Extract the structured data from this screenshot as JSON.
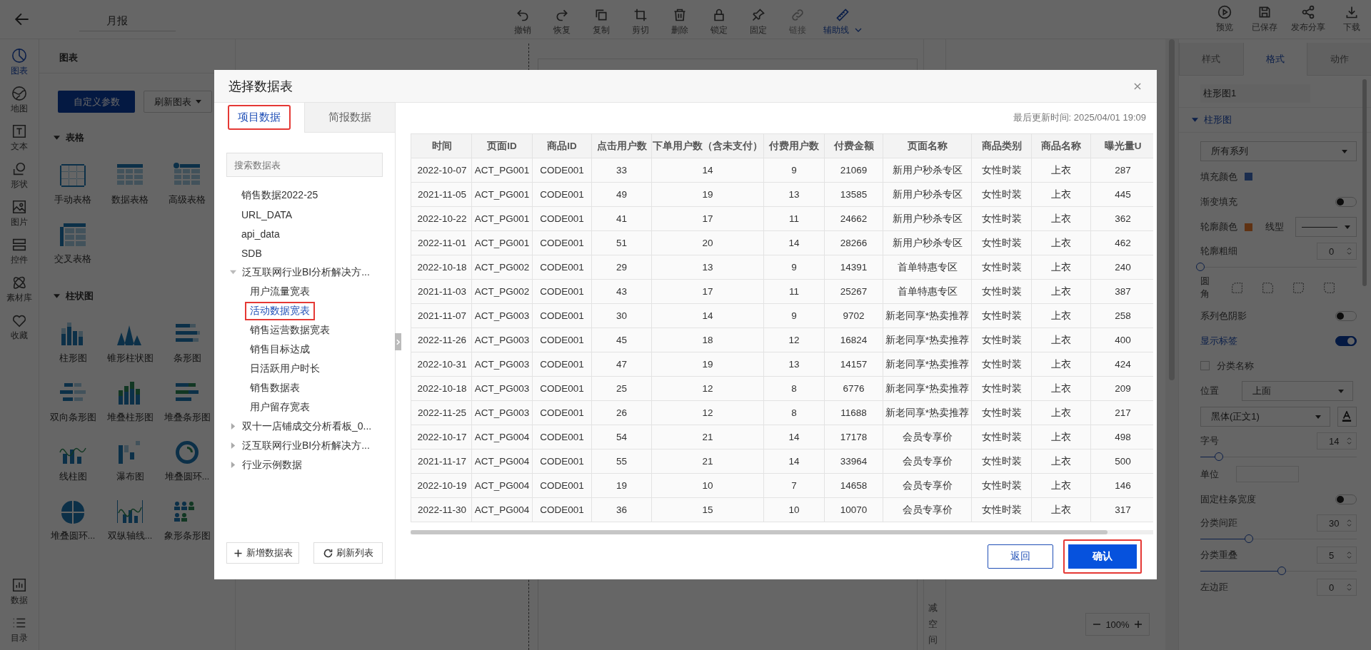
{
  "top_bar": {
    "title": "月报",
    "tools": [
      {
        "label": "撤销",
        "disabled": false,
        "selected": false,
        "has_menu": false
      },
      {
        "label": "恢复",
        "disabled": false,
        "selected": false,
        "has_menu": false
      },
      {
        "label": "复制",
        "disabled": false,
        "selected": false,
        "has_menu": false
      },
      {
        "label": "剪切",
        "disabled": false,
        "selected": false,
        "has_menu": false
      },
      {
        "label": "删除",
        "disabled": false,
        "selected": false,
        "has_menu": false
      },
      {
        "label": "锁定",
        "disabled": false,
        "selected": false,
        "has_menu": false
      },
      {
        "label": "固定",
        "disabled": false,
        "selected": false,
        "has_menu": false
      },
      {
        "label": "链接",
        "disabled": true,
        "selected": false,
        "has_menu": false
      },
      {
        "label": "辅助线",
        "disabled": false,
        "selected": true,
        "has_menu": true
      }
    ],
    "actions": [
      {
        "label": "预览"
      },
      {
        "label": "已保存"
      },
      {
        "label": "发布分享"
      },
      {
        "label": "下载"
      }
    ]
  },
  "rail": {
    "items": [
      {
        "label": "图表",
        "selected": true
      },
      {
        "label": "地图",
        "selected": false
      },
      {
        "label": "文本",
        "selected": false
      },
      {
        "label": "形状",
        "selected": false
      },
      {
        "label": "图片",
        "selected": false
      },
      {
        "label": "控件",
        "selected": false
      },
      {
        "label": "素材库",
        "selected": false
      },
      {
        "label": "收藏",
        "selected": false
      }
    ],
    "bottom_items": [
      {
        "label": "数据",
        "selected": false
      },
      {
        "label": "目录",
        "selected": false
      }
    ]
  },
  "left_panel": {
    "title": "图表",
    "buttons": [
      {
        "label": "自定义参数",
        "kind": "primary"
      },
      {
        "label": "刷新图表",
        "kind": "dropdown"
      }
    ],
    "sections": [
      {
        "title": "表格",
        "expanded": true,
        "items": [
          "手动表格",
          "数据表格",
          "高级表格",
          "交叉表格"
        ]
      },
      {
        "title": "柱状图",
        "expanded": true,
        "items": [
          "柱形图",
          "锥形柱状图",
          "条形图",
          "双向条形图",
          "堆叠柱形图",
          "堆叠条形图",
          "线柱图",
          "瀑布图",
          "堆叠圆环...",
          "堆叠圆环...",
          "双纵轴线...",
          "象形条形图"
        ]
      }
    ]
  },
  "canvas": {
    "side_text": "减空间",
    "zoom": "100%"
  },
  "right_panel": {
    "tabs": [
      {
        "label": "样式",
        "selected": false
      },
      {
        "label": "格式",
        "selected": true
      },
      {
        "label": "动作",
        "selected": false
      }
    ],
    "name": "柱形图1",
    "section": {
      "title": "柱形图",
      "expanded": true
    },
    "rows": [
      {
        "kind": "select",
        "value": "所有系列"
      },
      {
        "kind": "color",
        "label": "填充颜色"
      },
      {
        "kind": "toggle",
        "label": "渐变填充",
        "on": false
      },
      {
        "kind": "color-line",
        "label": "轮廓颜色",
        "label_2": "线型"
      },
      {
        "kind": "number",
        "label": "轮廓粗细",
        "value": "0",
        "level": 0
      },
      {
        "kind": "corners",
        "label": "圆角"
      },
      {
        "kind": "toggle",
        "label": "系列色阴影",
        "on": false
      },
      {
        "kind": "toggle",
        "label": "显示标签",
        "on": true
      },
      {
        "kind": "checkbox",
        "label": "分类名称",
        "checked": false
      },
      {
        "kind": "labeled-select",
        "label": "位置",
        "value": "上面"
      },
      {
        "kind": "font",
        "value": "黑体(正文1)"
      },
      {
        "kind": "number",
        "label": "字号",
        "value": "14",
        "level": 0.12
      },
      {
        "kind": "input",
        "label": "单位"
      },
      {
        "kind": "toggle",
        "label": "固定柱条宽度",
        "on": false
      },
      {
        "kind": "number",
        "label": "分类间距",
        "value": "30",
        "level": 0.31
      },
      {
        "kind": "number",
        "label": "分类重叠",
        "value": "5",
        "level": 0.52
      },
      {
        "kind": "number",
        "label": "左边距",
        "value": "0"
      }
    ]
  },
  "dialog": {
    "title": "选择数据表",
    "tabs": [
      {
        "label": "项目数据",
        "selected": true,
        "highlighted": true
      },
      {
        "label": "简报数据",
        "selected": false,
        "highlighted": false
      }
    ],
    "search": {
      "placeholder": "搜索数据表"
    },
    "tree": [
      {
        "label": "销售数据2022-25",
        "selected": false
      },
      {
        "label": "URL_DATA",
        "selected": false
      },
      {
        "label": "api_data",
        "selected": false
      },
      {
        "label": "SDB",
        "selected": false
      },
      {
        "label": "泛互联网行业BI分析解决方...",
        "expanded": true,
        "children": [
          {
            "label": "用户流量宽表",
            "selected": false,
            "highlighted": false
          },
          {
            "label": "活动数据宽表",
            "selected": true,
            "highlighted": true
          },
          {
            "label": "销售运营数据宽表",
            "selected": false,
            "highlighted": false
          },
          {
            "label": "销售目标达成",
            "selected": false,
            "highlighted": false
          },
          {
            "label": "日活跃用户时长",
            "selected": false,
            "highlighted": false
          },
          {
            "label": "销售数据表",
            "selected": false,
            "highlighted": false
          },
          {
            "label": "用户留存宽表",
            "selected": false,
            "highlighted": false
          }
        ]
      },
      {
        "label": "双十一店铺成交分析看板_0...",
        "expanded": false
      },
      {
        "label": "泛互联网行业BI分析解决方...",
        "expanded": false
      },
      {
        "label": "行业示例数据",
        "expanded": false
      }
    ],
    "list_buttons": [
      "新增数据表",
      "刷新列表"
    ],
    "updated": "最后更新时间: 2025/04/01 19:09",
    "table": {
      "columns": [
        "时间",
        "页面ID",
        "商品ID",
        "点击用户数",
        "下单用户数（含未支付）",
        "付费用户数",
        "付费金额",
        "页面名称",
        "商品类别",
        "商品名称",
        "曝光量U"
      ],
      "rows": [
        [
          "2022-10-07",
          "ACT_PG001",
          "CODE001",
          "33",
          "14",
          "9",
          "21069",
          "新用户秒杀专区",
          "女性时装",
          "上衣",
          "287"
        ],
        [
          "2021-11-05",
          "ACT_PG001",
          "CODE001",
          "49",
          "19",
          "13",
          "13585",
          "新用户秒杀专区",
          "女性时装",
          "上衣",
          "445"
        ],
        [
          "2022-10-22",
          "ACT_PG001",
          "CODE001",
          "41",
          "17",
          "11",
          "24662",
          "新用户秒杀专区",
          "女性时装",
          "上衣",
          "362"
        ],
        [
          "2022-11-01",
          "ACT_PG001",
          "CODE001",
          "51",
          "20",
          "14",
          "28266",
          "新用户秒杀专区",
          "女性时装",
          "上衣",
          "462"
        ],
        [
          "2022-10-18",
          "ACT_PG002",
          "CODE001",
          "29",
          "13",
          "9",
          "14391",
          "首单特惠专区",
          "女性时装",
          "上衣",
          "240"
        ],
        [
          "2021-11-03",
          "ACT_PG002",
          "CODE001",
          "43",
          "17",
          "11",
          "25267",
          "首单特惠专区",
          "女性时装",
          "上衣",
          "387"
        ],
        [
          "2021-11-07",
          "ACT_PG003",
          "CODE001",
          "30",
          "14",
          "9",
          "9702",
          "新老同享*热卖推荐",
          "女性时装",
          "上衣",
          "258"
        ],
        [
          "2022-11-26",
          "ACT_PG003",
          "CODE001",
          "45",
          "18",
          "12",
          "16824",
          "新老同享*热卖推荐",
          "女性时装",
          "上衣",
          "400"
        ],
        [
          "2022-10-31",
          "ACT_PG003",
          "CODE001",
          "47",
          "19",
          "13",
          "14157",
          "新老同享*热卖推荐",
          "女性时装",
          "上衣",
          "424"
        ],
        [
          "2022-10-18",
          "ACT_PG003",
          "CODE001",
          "25",
          "12",
          "8",
          "6776",
          "新老同享*热卖推荐",
          "女性时装",
          "上衣",
          "209"
        ],
        [
          "2022-11-25",
          "ACT_PG003",
          "CODE001",
          "26",
          "12",
          "8",
          "11688",
          "新老同享*热卖推荐",
          "女性时装",
          "上衣",
          "217"
        ],
        [
          "2022-10-17",
          "ACT_PG004",
          "CODE001",
          "54",
          "21",
          "14",
          "17178",
          "会员专享价",
          "女性时装",
          "上衣",
          "498"
        ],
        [
          "2021-11-17",
          "ACT_PG004",
          "CODE001",
          "55",
          "21",
          "14",
          "33964",
          "会员专享价",
          "女性时装",
          "上衣",
          "500"
        ],
        [
          "2022-10-19",
          "ACT_PG004",
          "CODE001",
          "19",
          "10",
          "7",
          "14658",
          "会员专享价",
          "女性时装",
          "上衣",
          "146"
        ],
        [
          "2022-11-30",
          "ACT_PG004",
          "CODE001",
          "36",
          "15",
          "10",
          "10070",
          "会员专享价",
          "女性时装",
          "上衣",
          "317"
        ]
      ]
    },
    "buttons": [
      {
        "label": "返回",
        "kind": "secondary",
        "highlighted": false
      },
      {
        "label": "确认",
        "kind": "primary",
        "highlighted": true
      }
    ]
  }
}
